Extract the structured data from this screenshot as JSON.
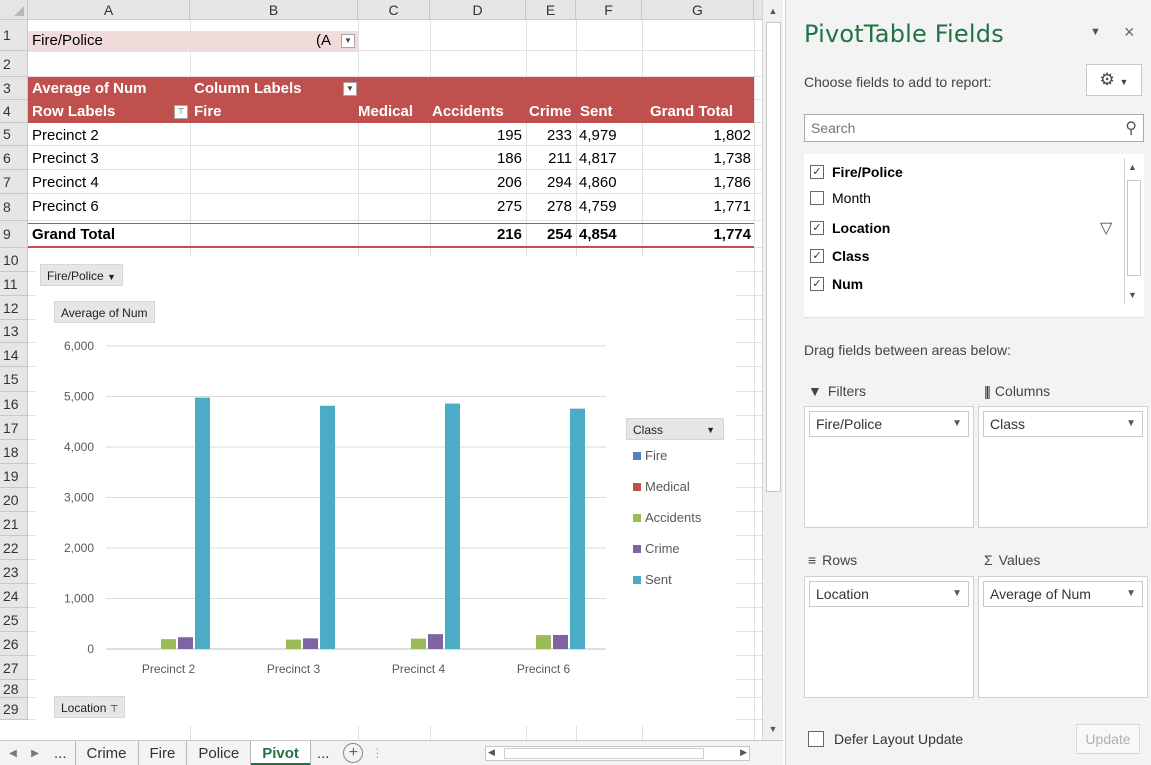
{
  "sheet": {
    "columns": [
      "A",
      "B",
      "C",
      "D",
      "E",
      "F",
      "G"
    ],
    "rows": [
      "1",
      "2",
      "3",
      "4",
      "5",
      "6",
      "7",
      "8",
      "9",
      "10",
      "11",
      "12",
      "13",
      "14",
      "15",
      "16",
      "17",
      "18",
      "19",
      "20",
      "21",
      "22",
      "23",
      "24",
      "25",
      "26",
      "27",
      "28",
      "29"
    ],
    "filter": {
      "label": "Fire/Police",
      "value": "(A"
    },
    "pivot": {
      "header_values": "Average of Num",
      "header_columns": "Column Labels",
      "header_rows": "Row Labels",
      "col_fire": "Fire",
      "col_medical": "Medical",
      "col_accidents": "Accidents",
      "col_crime": "Crime",
      "col_sent": "Sent",
      "col_total": "Grand Total",
      "rows": [
        {
          "label": "Precinct 2",
          "accidents": "195",
          "crime": "233",
          "sent": "4,979",
          "total": "1,802"
        },
        {
          "label": "Precinct 3",
          "accidents": "186",
          "crime": "211",
          "sent": "4,817",
          "total": "1,738"
        },
        {
          "label": "Precinct 4",
          "accidents": "206",
          "crime": "294",
          "sent": "4,860",
          "total": "1,786"
        },
        {
          "label": "Precinct 6",
          "accidents": "275",
          "crime": "278",
          "sent": "4,759",
          "total": "1,771"
        }
      ],
      "grand_total": {
        "label": "Grand Total",
        "accidents": "216",
        "crime": "254",
        "sent": "4,854",
        "total": "1,774"
      }
    },
    "chart_buttons": {
      "filter": "Fire/Police",
      "values": "Average of Num",
      "axis": "Location",
      "legend_title": "Class"
    },
    "tabs": [
      "...",
      "Crime",
      "Fire",
      "Police",
      "Pivot",
      "..."
    ],
    "active_tab": "Pivot"
  },
  "chart_data": {
    "type": "bar",
    "categories": [
      "Precinct 2",
      "Precinct 3",
      "Precinct 4",
      "Precinct 6"
    ],
    "series": [
      {
        "name": "Fire",
        "color": "#4f81bd",
        "values": [
          0,
          0,
          0,
          0
        ]
      },
      {
        "name": "Medical",
        "color": "#c0504d",
        "values": [
          0,
          0,
          0,
          0
        ]
      },
      {
        "name": "Accidents",
        "color": "#9bbb59",
        "values": [
          195,
          186,
          206,
          275
        ]
      },
      {
        "name": "Crime",
        "color": "#8064a2",
        "values": [
          233,
          211,
          294,
          278
        ]
      },
      {
        "name": "Sent",
        "color": "#4bacc6",
        "values": [
          4979,
          4817,
          4860,
          4759
        ]
      }
    ],
    "yticks": [
      "0",
      "1,000",
      "2,000",
      "3,000",
      "4,000",
      "5,000",
      "6,000"
    ],
    "ylim": [
      0,
      6000
    ],
    "grid": true,
    "legend_position": "right",
    "legend_title": "Class"
  },
  "pane": {
    "title": "PivotTable Fields",
    "choose_label": "Choose fields to add to report:",
    "search_placeholder": "Search",
    "fields": [
      {
        "label": "Fire/Police",
        "checked": true,
        "mark": "✓"
      },
      {
        "label": "Month",
        "checked": false,
        "mark": ""
      },
      {
        "label": "Location",
        "checked": true,
        "mark": "✓"
      },
      {
        "label": "Class",
        "checked": true,
        "mark": "✓"
      },
      {
        "label": "Num",
        "checked": true,
        "mark": "✓"
      }
    ],
    "drag_label": "Drag fields between areas below:",
    "areas": {
      "filters": {
        "title": "Filters",
        "item": "Fire/Police"
      },
      "columns": {
        "title": "Columns",
        "item": "Class"
      },
      "rows": {
        "title": "Rows",
        "item": "Location"
      },
      "values": {
        "title": "Values",
        "item": "Average of Num"
      }
    },
    "defer_label": "Defer Layout Update",
    "update_label": "Update"
  },
  "colors": {
    "accent_green": "#217346",
    "pivot_header": "#c0504d",
    "filter_cell": "#f2dcdb"
  }
}
